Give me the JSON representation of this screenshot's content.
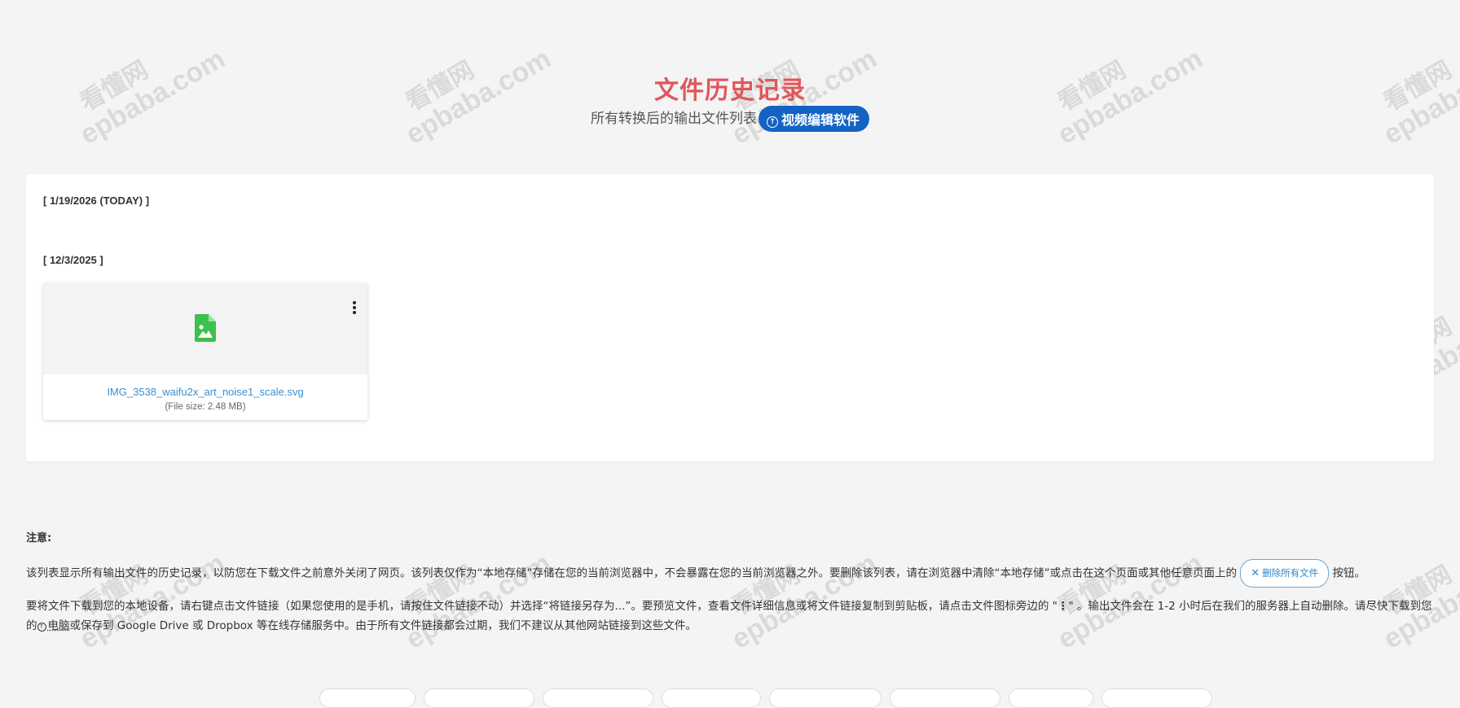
{
  "watermark": {
    "cn": "看懂网",
    "en": "epbaba.com"
  },
  "header": {
    "title": "文件历史记录",
    "subtitle": "所有转换后的输出文件列表",
    "promo_button": "视频编辑软件"
  },
  "history": {
    "groups": [
      {
        "date_label": "[ 1/19/2026 (TODAY) ]",
        "files": []
      },
      {
        "date_label": "[ 12/3/2025 ]",
        "files": [
          {
            "name": "IMG_3538_waifu2x_art_noise1_scale.svg",
            "size": "(File size: 2.48 MB)",
            "icon": "image-file-icon",
            "icon_color": "#3cc04f"
          }
        ]
      }
    ]
  },
  "notes": {
    "title": "注意:",
    "p1_before": "该列表显示所有输出文件的历史记录，以防您在下载文件之前意外关闭了网页。该列表仅作为“本地存储”存储在您的当前浏览器中，不会暴露在您的当前浏览器之外。要删除该列表，请在浏览器中清除“本地存储”或点击在这个页面或其他任意页面上的",
    "delete_all_button": "删除所有文件",
    "p1_after": "按钮。",
    "p2_before": "要将文件下载到您的本地设备，请右键点击文件链接（如果您使用的是手机，请按住文件链接不动）并选择“将链接另存为...”。要预览文件，查看文件详细信息或将文件链接复制到剪贴板，请点击文件图标旁边的 \"",
    "p2_dots": "⋮",
    "p2_mid": "\" 。输出文件会在 1-2 小时后在我们的服务器上自动删除。请尽快下载到您的",
    "pc_link": "电脑",
    "p2_after": "或保存到 Google Drive 或 Dropbox 等在线存储服务中。由于所有文件链接都会过期，我们不建议从其他网站链接到这些文件。"
  },
  "colors": {
    "title": "#e0575b",
    "promo_bg": "#1463c4",
    "link": "#3a8fd1"
  }
}
